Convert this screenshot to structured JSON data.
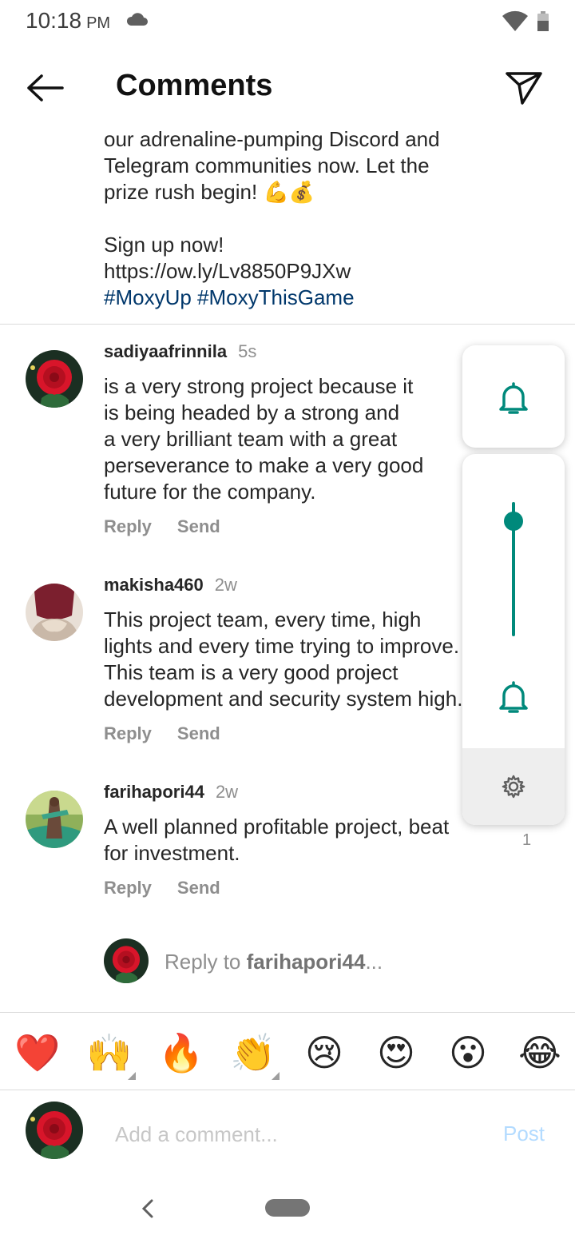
{
  "status_bar": {
    "time": "10:18",
    "ampm": "PM"
  },
  "header": {
    "title": "Comments"
  },
  "caption": {
    "lines": [
      "our adrenaline-pumping Discord and",
      "Telegram communities now. Let the",
      "prize rush begin! 💪💰",
      "",
      "Sign up now!",
      "https://ow.ly/Lv8850P9JXw"
    ],
    "hashtags": "#MoxyUp #MoxyThisGame"
  },
  "comments": [
    {
      "username": "sadiyaafrinnila",
      "time": "5s",
      "lines": [
        "is a very strong project because it",
        "is being headed by a strong and",
        "a very brilliant team with a great",
        "perseverance to make a very good",
        "future for the company."
      ],
      "reply_label": "Reply",
      "send_label": "Send"
    },
    {
      "username": "makisha460",
      "time": "2w",
      "lines": [
        "This project team, every time, high",
        "lights and every time trying to improve.",
        "This team is a very good project",
        "development and security system high."
      ],
      "reply_label": "Reply",
      "send_label": "Send"
    },
    {
      "username": "farihapori44",
      "time": "2w",
      "lines": [
        "A well planned profitable project, beat",
        "for investment."
      ],
      "reply_label": "Reply",
      "send_label": "Send",
      "likes": "1"
    }
  ],
  "reply_to": {
    "prefix": "Reply to ",
    "username": "farihapori44",
    "suffix": "..."
  },
  "emoji_bar": [
    "❤️",
    "🙌",
    "🔥",
    "👏",
    "😢",
    "😍",
    "😮",
    "😂"
  ],
  "comment_box": {
    "placeholder": "Add a comment...",
    "post_label": "Post"
  },
  "volume_panel": {
    "ring_level_percent": 85,
    "accent_color": "#00897b"
  }
}
